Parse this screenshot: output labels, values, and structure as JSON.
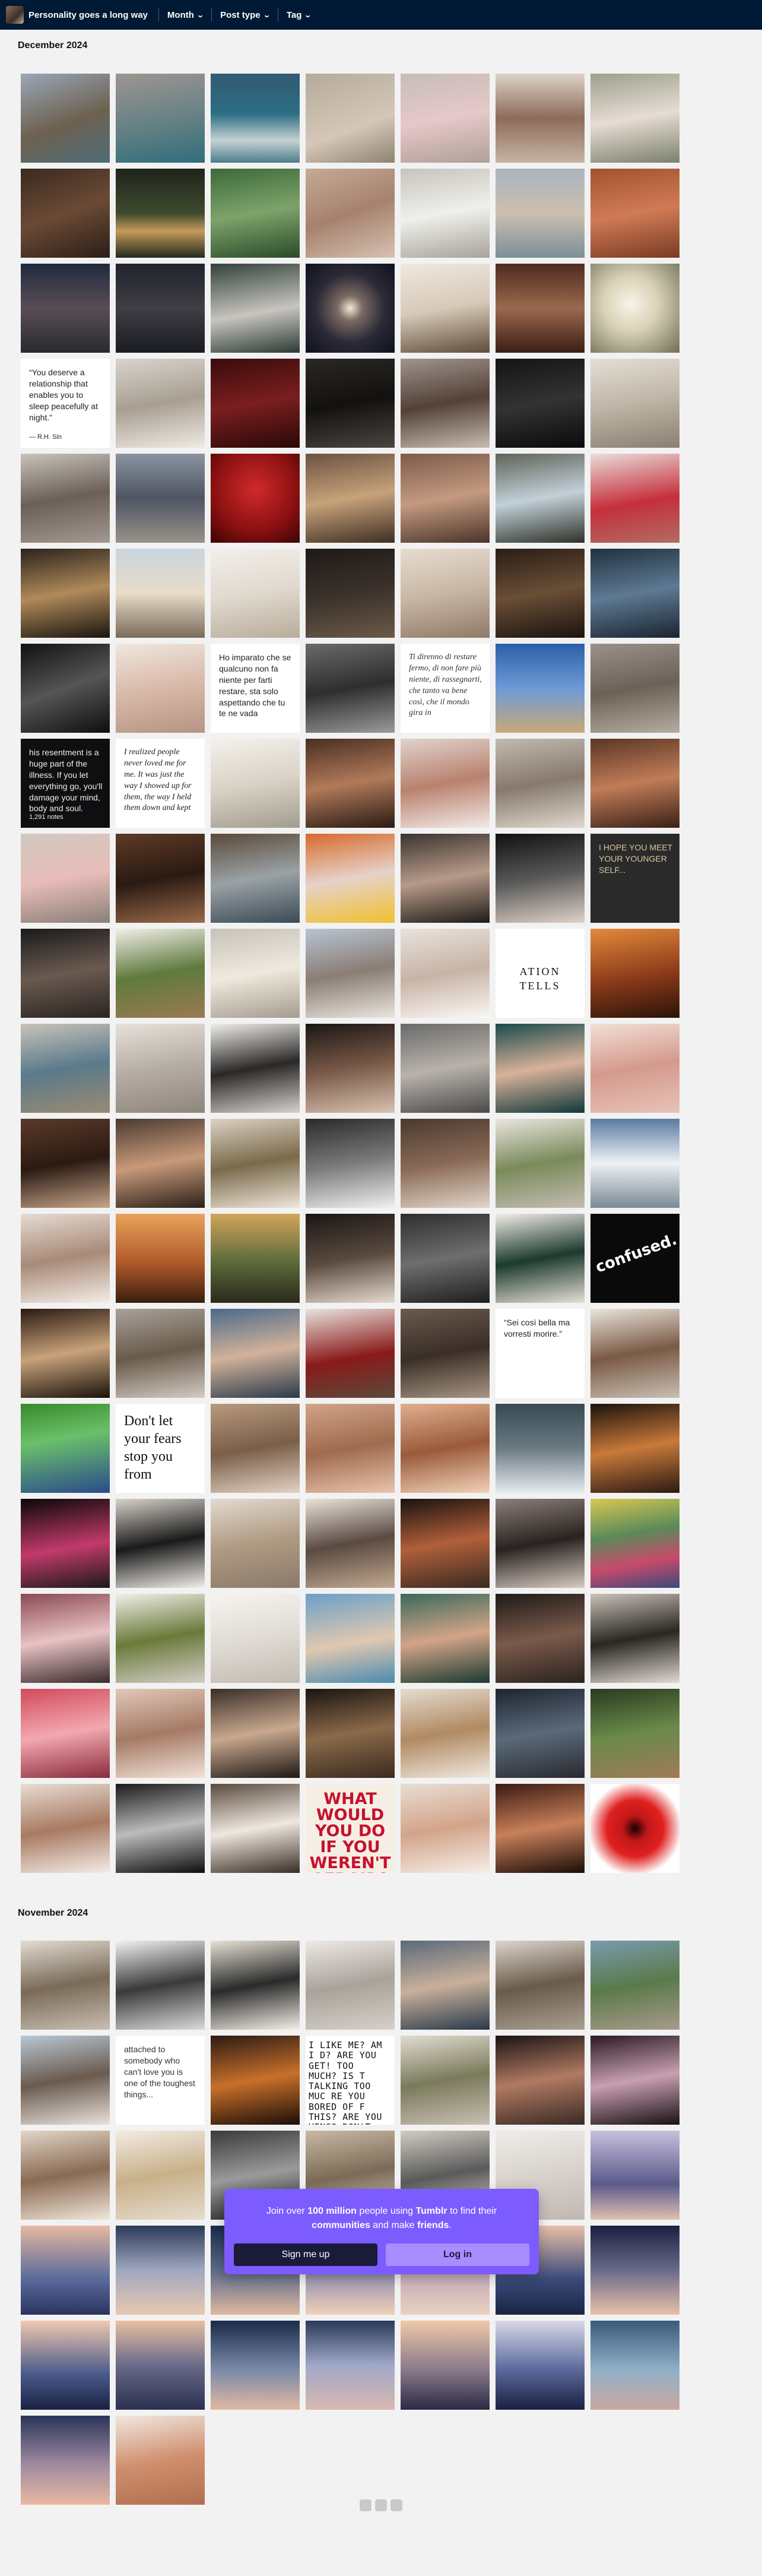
{
  "header": {
    "blog_title": "Personality goes a long way",
    "filters": [
      {
        "label": "Month"
      },
      {
        "label": "Post type"
      },
      {
        "label": "Tag"
      }
    ]
  },
  "sections": [
    {
      "heading": "December 2024",
      "tiles": [
        {
          "bg": "linear-gradient(160deg,#9aa7b8,#6d6150 55%,#4e6c77)"
        },
        {
          "bg": "linear-gradient(170deg,#9d9590,#5f7f83 60%,#2f6d7c)"
        },
        {
          "bg": "linear-gradient(180deg,#315a73,#2c6e84 45%,#c5d2d2 75%,#4a7d8c)"
        },
        {
          "bg": "linear-gradient(160deg,#b5aa9b,#d4c7b7 60%,#8e8271)"
        },
        {
          "bg": "linear-gradient(170deg,#c7bdb6,#e6c8c9 50%,#b0a097)"
        },
        {
          "bg": "linear-gradient(180deg,#dcd2c8,#8d6b58 50%,#c7b4a5)"
        },
        {
          "bg": "linear-gradient(170deg,#9ca08e,#e6dcd3 50%,#7b806d)"
        },
        {
          "bg": "linear-gradient(160deg,#3a2a20,#6b4a35 50%,#2a1e16)"
        },
        {
          "bg": "linear-gradient(180deg,#1f241c,#3e4a2e 50%,#c49a5a 70%,#24291e)"
        },
        {
          "bg": "linear-gradient(170deg,#3c6a3a,#7da36a 50%,#2b4a2a)"
        },
        {
          "bg": "linear-gradient(160deg,#c5aa96,#a6826e 50%,#d7c1b1)"
        },
        {
          "bg": "linear-gradient(170deg,#c8c4bd,#efefeb 50%,#a7a39a)"
        },
        {
          "bg": "linear-gradient(180deg,#a9b4bf,#cbbfaf 50%,#7b8f97)"
        },
        {
          "bg": "linear-gradient(170deg,#a2512f,#d07b55 50%,#7a3a23)"
        },
        {
          "bg": "linear-gradient(180deg,#1f2a3e,#5a4d55 50%,#2a2a30)"
        },
        {
          "bg": "linear-gradient(180deg,#20242c,#3f3e44 50%,#1a1c22)"
        },
        {
          "bg": "linear-gradient(170deg,#30423a,#c8c4bf 55%,#2b3a33)"
        },
        {
          "bg": "radial-gradient(circle at 50% 50%,#f5e9d5 0%,#7a6a63 20%,#2b2a36 55%,#0e1020 100%)"
        },
        {
          "bg": "linear-gradient(170deg,#efe8e0,#d7c9b8 50%,#5f4c3a)"
        },
        {
          "bg": "linear-gradient(180deg,#4e2b1f,#9a6a4e 50%,#3a1e14)"
        },
        {
          "bg": "radial-gradient(circle at 45% 45%,#f7f3e8 0%,#d9d1b7 40%,#6d6e54 100%)"
        },
        {
          "bg": "#ffffff",
          "text": "“You deserve a relationship that enables you to sleep peacefully at night.”",
          "sub": "— R.H. Sin",
          "cls": "sans",
          "color": "#222"
        },
        {
          "bg": "linear-gradient(170deg,#d8d4cc,#a89f92 50%,#efeae3)"
        },
        {
          "bg": "linear-gradient(170deg,#3a0c0c,#7a1e1e 50%,#2a0808)"
        },
        {
          "bg": "linear-gradient(170deg,#2a2724,#13110f 50%,#4a4540)"
        },
        {
          "bg": "linear-gradient(170deg,#a0948c,#534138 50%,#c8bcb1)"
        },
        {
          "bg": "linear-gradient(170deg,#141414,#333 50%,#0a0a0a)"
        },
        {
          "bg": "linear-gradient(170deg,#e4ded4,#bfb5a7 50%,#8a7f71)"
        },
        {
          "bg": "linear-gradient(170deg,#c8c3bc,#6b5f57 50%,#a39990)"
        },
        {
          "bg": "linear-gradient(180deg,#8a93a0,#4e5563 50%,#9a928a)"
        },
        {
          "bg": "radial-gradient(circle at 50% 40%,#d02a2a,#8a1010 60%,#3a0505)"
        },
        {
          "bg": "linear-gradient(170deg,#6b5240,#c7a27a 50%,#3e2e22)"
        },
        {
          "bg": "linear-gradient(170deg,#7c5a4a,#c49a80 50%,#4a3428)"
        },
        {
          "bg": "linear-gradient(170deg,#5f6358,#c2d0d8 50%,#2e3128)"
        },
        {
          "bg": "linear-gradient(170deg,#e9ddd8,#c52f3c 55%,#b06d60)"
        },
        {
          "bg": "linear-gradient(170deg,#2a231c,#b08a5a 50%,#1a150f)"
        },
        {
          "bg": "linear-gradient(180deg,#c9d5df,#e8dcc8 50%,#7a6a5a)"
        },
        {
          "bg": "linear-gradient(170deg,#f2efea,#e0d9ce 50%,#b9ac9a)"
        },
        {
          "bg": "linear-gradient(170deg,#1e1a18,#3b312b 50%,#6a5a48)"
        },
        {
          "bg": "linear-gradient(170deg,#e7dcd0,#c8b6a4 50%,#8f7a67)"
        },
        {
          "bg": "linear-gradient(170deg,#2a1e16,#6a4e36 50%,#1b140e)"
        },
        {
          "bg": "linear-gradient(170deg,#20303e,#5e7a94 50%,#1a2430)"
        },
        {
          "bg": "linear-gradient(160deg,#111,#555 50%,#0e0e0e)"
        },
        {
          "bg": "linear-gradient(170deg,#efe7df,#d9b9a8 50%,#b59484)"
        },
        {
          "bg": "#ffffff",
          "text": "Ho imparato che se qualcuno non fa niente per farti restare, sta solo aspettando che tu te ne vada",
          "cls": "sans",
          "color": "#222"
        },
        {
          "bg": "linear-gradient(170deg,#6a6a6a,#2e2e2e 50%,#9a9a9a)"
        },
        {
          "bg": "#ffffff",
          "text": "Ti direnno di restare fermo, di non fare più niente, di rassegnarti, che tanto va bene così, che il mondo gira in",
          "cls": "",
          "color": "#333"
        },
        {
          "bg": "linear-gradient(180deg,#2a5fa8,#6d9ad6 50%,#c9a978)"
        },
        {
          "bg": "linear-gradient(170deg,#9a9188,#6b6157 50%,#b5aca2)"
        },
        {
          "bg": "#0f0f12",
          "text": "his resentment is a huge part of the illness. If you let everything go, you'll damage your mind, body and soul.",
          "cls": "sans light",
          "color": "#eee",
          "sub": "1,291 notes"
        },
        {
          "bg": "#ffffff",
          "text": "I realized people never loved me for me. It was just the way I showed up for them, the way I held them down and kept",
          "cls": "",
          "color": "#222"
        },
        {
          "bg": "linear-gradient(170deg,#f4f1ec,#d9d2c6 50%,#a39c90)"
        },
        {
          "bg": "linear-gradient(170deg,#4a2e22,#b07a5a 50%,#2a1a12)"
        },
        {
          "bg": "linear-gradient(170deg,#e0d3cc,#b9816e 50%,#f2eae5)"
        },
        {
          "bg": "linear-gradient(170deg,#c2b9ae,#877a6d 50%,#e0d8cf)"
        },
        {
          "bg": "linear-gradient(170deg,#5a3624,#c07c58 50%,#3a2016)"
        },
        {
          "bg": "linear-gradient(170deg,#d1c8c0,#e8bcb8 50%,#8a7f76)"
        },
        {
          "bg": "linear-gradient(170deg,#5e3a26,#2a1a12 50%,#9a6a4a)"
        },
        {
          "bg": "linear-gradient(170deg,#5a4a3a,#9aa2a4 50%,#3a4a56)"
        },
        {
          "bg": "linear-gradient(170deg,#d66a2a,#e6d2c8 50%,#f0c030)"
        },
        {
          "bg": "linear-gradient(170deg,#3a3430,#b79a88 50%,#1f1b18)"
        },
        {
          "bg": "linear-gradient(170deg,#101010,#5a5a5a 50%,#e0d2c8)"
        },
        {
          "bg": "#2a2a2a",
          "text": "I HOPE YOU MEET YOUR YOUNGER SELF...",
          "cls": "sans",
          "color": "#d9c6a4"
        },
        {
          "bg": "linear-gradient(170deg,#1a1a1a,#6a5a50 50%,#2a2421)"
        },
        {
          "bg": "linear-gradient(170deg,#f2efe8,#5f7a3e 50%,#9a7a52)"
        },
        {
          "bg": "linear-gradient(170deg,#c7c2b7,#efe9de 50%,#a59c8f)"
        },
        {
          "bg": "linear-gradient(170deg,#b8c4d2,#8a7d74 50%,#eae5df)"
        },
        {
          "bg": "linear-gradient(170deg,#e8e2dc,#c8b3a6 50%,#faf7f3)"
        },
        {
          "bg": "#ffffff",
          "text": "ATION TELLS",
          "cls": "wide",
          "color": "#111"
        },
        {
          "bg": "linear-gradient(170deg,#e48a3a,#8a3a1a 55%,#2a1408)"
        },
        {
          "bg": "linear-gradient(170deg,#c8c3b9,#5a7a8a 50%,#9a8a72)"
        },
        {
          "bg": "linear-gradient(170deg,#e6e1da,#b5ada3 50%,#8e867c)"
        },
        {
          "bg": "linear-gradient(170deg,#f1efec,#2a2826 50%,#d6d2cc)"
        },
        {
          "bg": "linear-gradient(170deg,#1a1514,#7a5a48 50%,#d9c2b0)"
        },
        {
          "bg": "linear-gradient(170deg,#6a6a6a,#b8b2aa 50%,#4a4a4a)"
        },
        {
          "bg": "linear-gradient(170deg,#1a4a4a,#d8b29a 50%,#12383a)"
        },
        {
          "bg": "linear-gradient(170deg,#f2dfd6,#d49a8c 50%,#e8c2b8)"
        },
        {
          "bg": "linear-gradient(170deg,#5a3a2a,#2a1a12 50%,#c7a58a)"
        },
        {
          "bg": "linear-gradient(170deg,#4a3a30,#c89a7a 50%,#2a2018)"
        },
        {
          "bg": "linear-gradient(170deg,#dcd2c4,#7a6a4a 50%,#efe6da)"
        },
        {
          "bg": "linear-gradient(170deg,#2a2a2a,#7a7a7a 50%,#f0f0f0)"
        },
        {
          "bg": "linear-gradient(170deg,#4a3a30,#8a6a56 50%,#e2d6ca)"
        },
        {
          "bg": "linear-gradient(170deg,#eae6df,#7a8a5a 50%,#c4bdb2)"
        },
        {
          "bg": "linear-gradient(180deg,#5a7aa0,#eef2f6 50%,#7a8a94)"
        },
        {
          "bg": "linear-gradient(170deg,#e6dbd2,#a88a78 50%,#f4ede6)"
        },
        {
          "bg": "linear-gradient(180deg,#e8a35a,#b05a2a 55%,#3a1e10)"
        },
        {
          "bg": "linear-gradient(180deg,#d2a45a,#5a6a3a 55%,#2a2a1a)"
        },
        {
          "bg": "linear-gradient(170deg,#1a1614,#5a4a3e 50%,#e6dad0)"
        },
        {
          "bg": "linear-gradient(170deg,#2e2e2e,#6e6e6e 50%,#1e1e1e)"
        },
        {
          "bg": "linear-gradient(170deg,#f2eee8,#1c3a2e 50%,#e6dfd5)"
        },
        {
          "bg": "#0a0a0a",
          "text": "confused.",
          "cls": "curvy",
          "color": "#fff"
        },
        {
          "bg": "linear-gradient(170deg,#2a1a12,#c8a27a 50%,#1a120c)"
        },
        {
          "bg": "linear-gradient(170deg,#a8a29a,#6a5a4a 50%,#d2ccc4)"
        },
        {
          "bg": "linear-gradient(170deg,#4a6a8a,#d2b29a 50%,#2a3a4a)"
        },
        {
          "bg": "linear-gradient(170deg,#e8e4de,#8a1a1a 55%,#5a4a3a)"
        },
        {
          "bg": "linear-gradient(170deg,#6a5a4e,#3a2e26 50%,#a89684)"
        },
        {
          "bg": "#ffffff",
          "text": "“Sei così bella ma vorresti morire.”",
          "cls": "sans",
          "color": "#222"
        },
        {
          "bg": "linear-gradient(170deg,#eae4dd,#7a5a44 50%,#c9bfb4)"
        },
        {
          "bg": "linear-gradient(170deg,#3a8a2a,#6ac06a 40%,#2a4a8a)"
        },
        {
          "bg": "#ffffff",
          "text": "Don't let your fears stop you from",
          "cls": "serif-big",
          "color": "#111"
        },
        {
          "bg": "linear-gradient(170deg,#b89a7e,#7a5e48 50%,#e2d2c2)"
        },
        {
          "bg": "linear-gradient(170deg,#d2a488,#a06a4e 50%,#e8c4ac)"
        },
        {
          "bg": "linear-gradient(170deg,#e0b090,#9a5a3a 50%,#f2d2b8)"
        },
        {
          "bg": "linear-gradient(180deg,#3a4a52,#6a7a82 50%,#e6ecef)"
        },
        {
          "bg": "linear-gradient(170deg,#1a120c,#c87a3a 50%,#2a1a10)"
        },
        {
          "bg": "linear-gradient(170deg,#080808,#c23a6a 55%,#1a1a1a)"
        },
        {
          "bg": "linear-gradient(170deg,#d8d2ca,#1a1a1a 50%,#f2eee8)"
        },
        {
          "bg": "linear-gradient(170deg,#e2dad0,#b09a82 50%,#8a7a6a)"
        },
        {
          "bg": "linear-gradient(170deg,#eae2da,#5a4a42 50%,#c2a890)"
        },
        {
          "bg": "linear-gradient(170deg,#1a1210,#b0603a 50%,#3a2a20)"
        },
        {
          "bg": "linear-gradient(170deg,#8a8078,#2a2220 50%,#d6ccc2)"
        },
        {
          "bg": "linear-gradient(170deg,#d8c850,#5a8a5a 40%,#c84a6a 70%,#3a4a7a)"
        },
        {
          "bg": "linear-gradient(170deg,#8a4a52,#e8c2c4 50%,#3a2a2a)"
        },
        {
          "bg": "linear-gradient(170deg,#f2efe9,#6a7a3a 50%,#d2cdc4)"
        },
        {
          "bg": "linear-gradient(170deg,#f6f4f0,#e0dbd4 50%,#c2bbb2)"
        },
        {
          "bg": "linear-gradient(170deg,#6aa0c8,#e0c8b0 55%,#4a8ab0)"
        },
        {
          "bg": "linear-gradient(170deg,#3a6a5a,#d2a488 50%,#1a3a30)"
        },
        {
          "bg": "linear-gradient(170deg,#1e1a18,#7a5a4a 50%,#2a2220)"
        },
        {
          "bg": "linear-gradient(170deg,#c8c2b8,#2a2622 50%,#e0dad2)"
        },
        {
          "bg": "linear-gradient(170deg,#d24a5a,#f2a8b0 50%,#8a2a3a)"
        },
        {
          "bg": "linear-gradient(170deg,#e2c8b8,#a47a64 50%,#f2e2d8)"
        },
        {
          "bg": "linear-gradient(170deg,#3a2e28,#c8a88e 50%,#1e1814)"
        },
        {
          "bg": "linear-gradient(170deg,#1a1410,#8a6a4a 50%,#3a2a1e)"
        },
        {
          "bg": "linear-gradient(170deg,#e6dccf,#b08a62 50%,#f0e8de)"
        },
        {
          "bg": "linear-gradient(170deg,#1e2430,#5a6a7a 50%,#2a2a30)"
        },
        {
          "bg": "linear-gradient(170deg,#2a3a20,#6a8a4a 50%,#a07a5a)"
        },
        {
          "bg": "linear-gradient(170deg,#e8ddd4,#a87a62 50%,#f4ece6)"
        },
        {
          "bg": "linear-gradient(170deg,#1a1a1a,#bcbcbc 50%,#0e0e0e)"
        },
        {
          "bg": "linear-gradient(170deg,#5a4a3e,#efe8e0 50%,#3a2e24)"
        },
        {
          "bg": "#f5efe3",
          "text": "WHAT WOULD YOU DO IF YOU WEREN'T AFRAID?",
          "cls": "bigred",
          "color": "#c8102e"
        },
        {
          "bg": "linear-gradient(170deg,#e8ded4,#d2a48a 50%,#f6eee6)"
        },
        {
          "bg": "linear-gradient(170deg,#3a1a12,#c8805a 50%,#1a0e08)"
        },
        {
          "bg": "radial-gradient(circle at 50% 50%,#1a0000 0%,#c01818 20%,#e02020 45%,#ffffff 75%)"
        }
      ]
    },
    {
      "heading": "November 2024",
      "tiles": [
        {
          "bg": "linear-gradient(170deg,#e2dcd2,#7a6a58 50%,#c8beb0)"
        },
        {
          "bg": "linear-gradient(170deg,#f2f2f2,#3a3a3a 50%,#dadada)"
        },
        {
          "bg": "linear-gradient(170deg,#e8e2d6,#2a2a2a 50%,#f4efe6)"
        },
        {
          "bg": "linear-gradient(170deg,#eeeae4,#a8a29a 50%,#d6d0c8)"
        },
        {
          "bg": "linear-gradient(170deg,#5a6a7a,#c8b09a 50%,#2a3a4a)"
        },
        {
          "bg": "linear-gradient(170deg,#dcd6ce,#6a5a4a 50%,#a8a092)"
        },
        {
          "bg": "linear-gradient(170deg,#7a9ab0,#5a7a4a 50%,#a89a8a)"
        },
        {
          "bg": "linear-gradient(170deg,#b8c8d4,#6a5a4e 50%,#e8e2dc)"
        },
        {
          "bg": "#ffffff",
          "text": "attached to somebody who can't love you is one of the toughest things...",
          "cls": "sans",
          "color": "#333"
        },
        {
          "bg": "linear-gradient(170deg,#2a1a14,#c8702a 50%,#1a0e08)"
        },
        {
          "bg": "#ffffff",
          "text": "I LIKE ME? AM I D? ARE YOU GET! TOO MUCH? IS T TALKING TOO MUC RE YOU BORED OF F THIS? ARE YOU VING? DON'T LEA FOREVER PLEASE.",
          "cls": "mono",
          "color": "#111"
        },
        {
          "bg": "linear-gradient(170deg,#e2dcd2,#7a7a5a 50%,#c8c0b4)"
        },
        {
          "bg": "linear-gradient(170deg,#1a1414,#b07a62 50%,#3a2a24)"
        },
        {
          "bg": "linear-gradient(170deg,#2a1a24,#c8a0b0 50%,#1a1016)"
        },
        {
          "bg": "linear-gradient(170deg,#e2d6c8,#8a6a52 50%,#f0e6da)"
        },
        {
          "bg": "linear-gradient(170deg,#f2ece2,#c8b08a 50%,#e6dccc)"
        },
        {
          "bg": "linear-gradient(170deg,#3a3a3a,#9a9a9a 50%,#1a1a1a)"
        },
        {
          "bg": "linear-gradient(170deg,#c8b8a4,#7a6a56 50%,#e6dccf)"
        },
        {
          "bg": "linear-gradient(170deg,#d2ccc2,#5a5a5a 50%,#eae4dc)"
        },
        {
          "bg": "linear-gradient(170deg,#f0ece8,#d8d2cc 50%,#c0b8b0)"
        },
        {
          "bg": "linear-gradient(180deg,#c8c0dc,#5a5a8a 60%,#e0c0b0)"
        },
        {
          "bg": "linear-gradient(180deg,#e6b8a0,#5a6a9a 60%,#2a3460)"
        },
        {
          "bg": "linear-gradient(180deg,#2a3a5a,#a0a8c0 50%,#e8c8b0)"
        },
        {
          "bg": "linear-gradient(180deg,#1a2a4a,#5a6a8a 50%,#e0b8a0)"
        },
        {
          "bg": "linear-gradient(180deg,#2a3458,#8a8ab0 50%,#f0d0b8)"
        },
        {
          "bg": "linear-gradient(180deg,#3a4a6a,#c0a8b8 50%,#e8d0c0)"
        },
        {
          "bg": "linear-gradient(180deg,#e8c0a8,#3a4a7a 60%,#1a2444)"
        },
        {
          "bg": "linear-gradient(180deg,#1a2040,#6a6a8a 50%,#e8c0a8)"
        },
        {
          "bg": "linear-gradient(180deg,#f0c8b0,#4a5a8a 60%,#1a2244)"
        },
        {
          "bg": "linear-gradient(180deg,#e8c0a0,#6a6a8a 50%,#2a3050)"
        },
        {
          "bg": "linear-gradient(180deg,#1a2a4a,#7a8aa8 55%,#e0b8a0)"
        },
        {
          "bg": "linear-gradient(180deg,#2a3a5a,#a0a8c8 50%,#d8b8b0)"
        },
        {
          "bg": "linear-gradient(180deg,#f0c8a8,#8a7a8a 55%,#2a2a44)"
        },
        {
          "bg": "linear-gradient(180deg,#d8d8e8,#5a6a9a 55%,#1a2040)"
        },
        {
          "bg": "linear-gradient(180deg,#3a5a7a,#90b0c8 55%,#c8a8a0)"
        },
        {
          "bg": "linear-gradient(180deg,#2a3458,#a08aa0 55%,#e8b8a0)"
        },
        {
          "bg": "linear-gradient(170deg,#f0e8e0,#d09070 50%,#b07050)"
        }
      ]
    }
  ],
  "modal": {
    "line1_a": "Join over ",
    "line1_b": "100 million",
    "line1_c": " people using ",
    "line1_d": "Tumblr",
    "line1_e": " to find their",
    "line2_a": "communities",
    "line2_b": " and make ",
    "line2_c": "friends",
    "line2_d": ".",
    "signup_label": "Sign me up",
    "login_label": "Log in"
  }
}
